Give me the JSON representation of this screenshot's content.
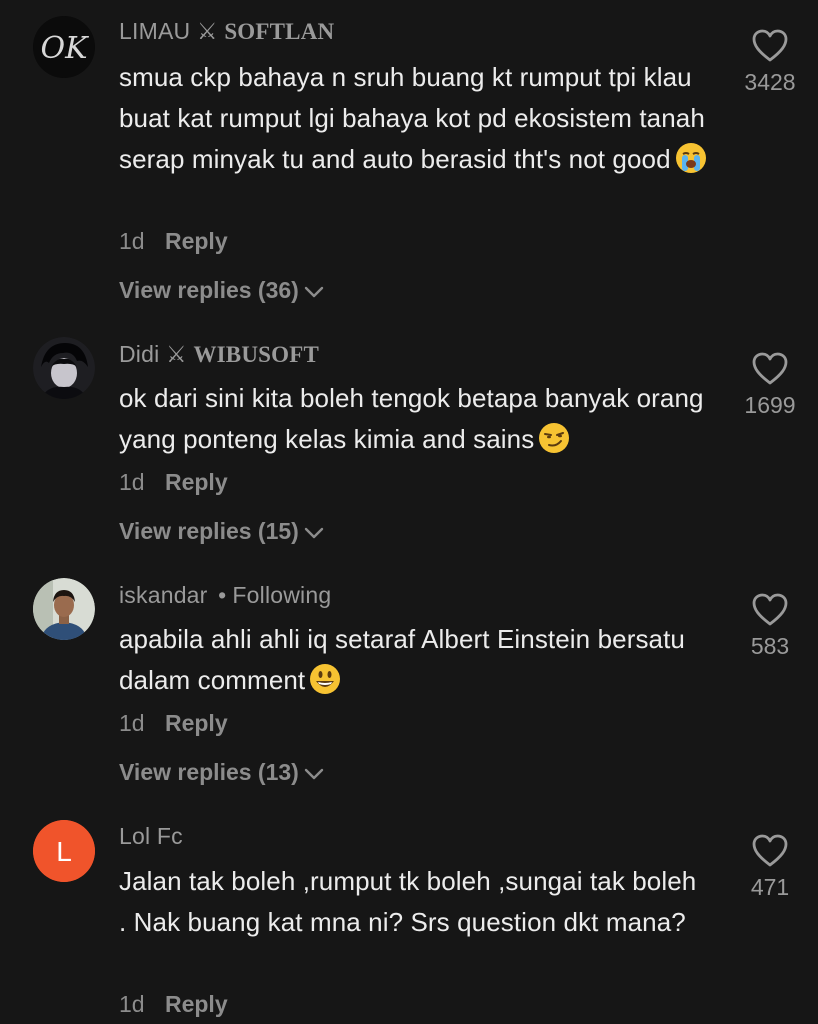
{
  "comments": [
    {
      "username": "LIMAU",
      "tag": "SOFTLAN",
      "text": "smua ckp bahaya n sruh buang kt rumput tpi klau buat kat rumput lgi bahaya kot pd ekosistem tanah serap minyak tu and auto berasid tht's not good",
      "emoji": "loudly-crying-face",
      "avatar_text": "OK",
      "time": "1d",
      "reply_label": "Reply",
      "view_replies": "View replies (36)",
      "likes": "3428"
    },
    {
      "username": "Didi",
      "tag": "WIBUSOFT",
      "text": "ok dari sini kita boleh tengok betapa banyak orang yang ponteng kelas kimia and sains",
      "emoji": "smirking-face",
      "time": "1d",
      "reply_label": "Reply",
      "view_replies": "View replies (15)",
      "likes": "1699"
    },
    {
      "username": "iskandar",
      "status": "Following",
      "text": "apabila ahli ahli iq setaraf Albert Einstein bersatu dalam comment",
      "emoji": "grinning-face",
      "time": "1d",
      "reply_label": "Reply",
      "view_replies": "View replies (13)",
      "likes": "583"
    },
    {
      "username": "Lol Fc",
      "text": "Jalan tak boleh ,rumput tk boleh ,sungai tak boleh . Nak buang kat mna ni? Srs question dkt mana?",
      "avatar_letter": "L",
      "avatar_color": "#f0542b",
      "time": "1d",
      "reply_label": "Reply",
      "likes": "471"
    }
  ],
  "colors": {
    "background": "#161616",
    "primary_text": "#ececec",
    "secondary_text": "#9a9a9a"
  },
  "icons": {
    "like": "heart-outline-icon",
    "expand": "chevron-down-icon",
    "name_separator": "crossed-swords-symbol"
  }
}
